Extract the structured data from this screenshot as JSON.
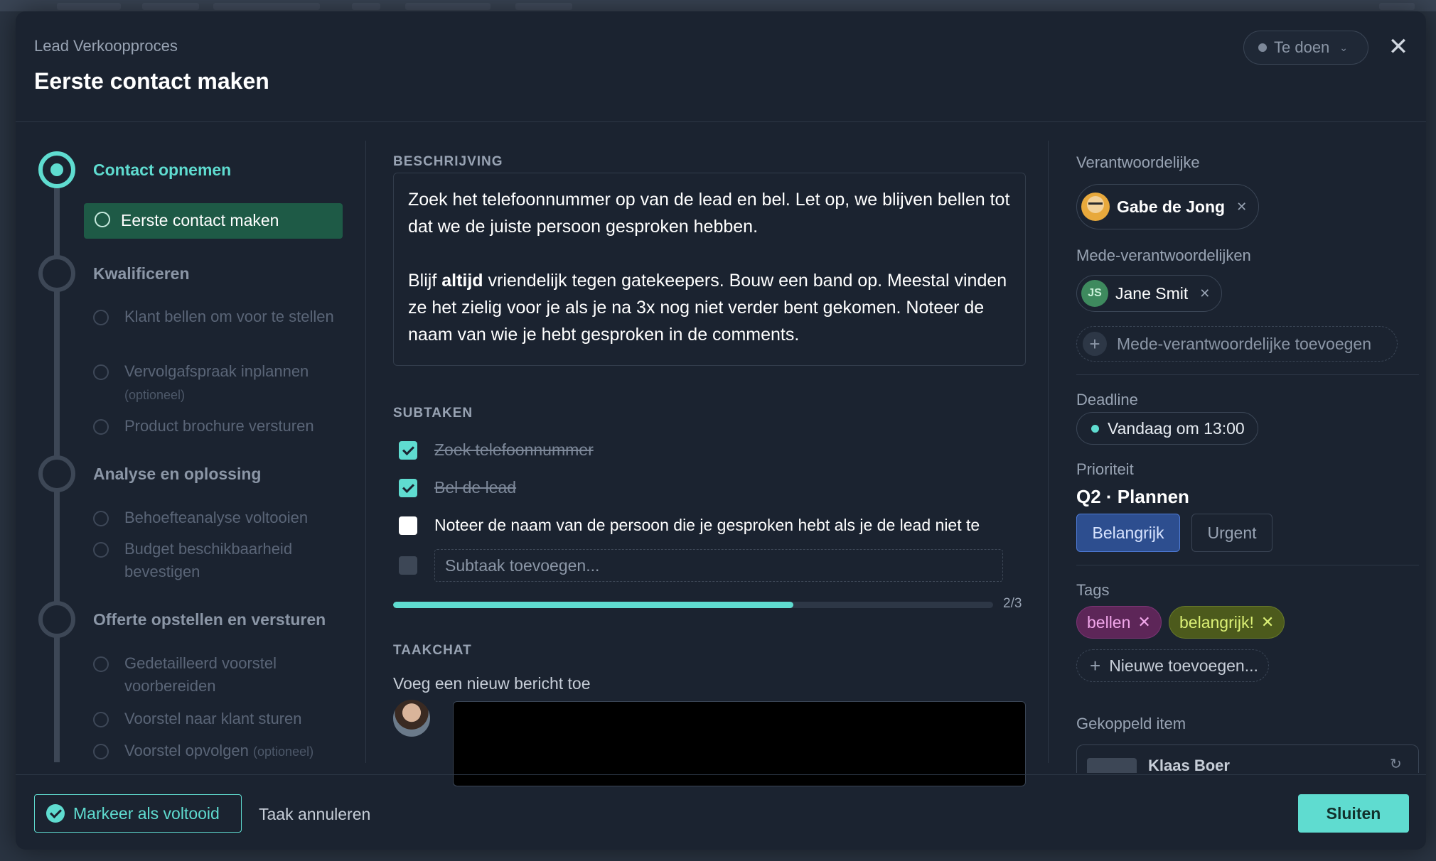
{
  "header": {
    "breadcrumb": "Lead Verkoopproces",
    "title": "Eerste contact maken",
    "status": "Te doen"
  },
  "stepper": {
    "phases": [
      {
        "title": "Contact opnemen",
        "active": true,
        "items": [
          {
            "label": "Eerste contact maken",
            "active": true
          }
        ]
      },
      {
        "title": "Kwalificeren",
        "items": [
          {
            "label": "Klant bellen om voor te stellen"
          },
          {
            "label": "Vervolgafspraak inplannen",
            "optional": "(optioneel)"
          },
          {
            "label": "Product brochure versturen"
          }
        ]
      },
      {
        "title": "Analyse en oplossing",
        "items": [
          {
            "label": "Behoefteanalyse voltooien"
          },
          {
            "label": "Budget beschikbaarheid bevestigen"
          }
        ]
      },
      {
        "title": "Offerte opstellen en versturen",
        "items": [
          {
            "label": "Gedetailleerd voorstel voorbereiden"
          },
          {
            "label": "Voorstel naar klant sturen"
          },
          {
            "label": "Voorstel opvolgen",
            "optional": "(optioneel)"
          }
        ]
      }
    ]
  },
  "description": {
    "label": "BESCHRIJVING",
    "p1": "Zoek het telefoonnummer op van de lead en bel. Let op, we blijven bellen tot dat we de juiste persoon gesproken hebben.",
    "p2_pre": "Blijf ",
    "p2_bold": "altijd",
    "p2_post": " vriendelijk tegen gatekeepers. Bouw een band op. Meestal vinden ze het zielig voor je als je na 3x nog niet verder bent gekomen. Noteer de naam van wie je hebt gesproken in de comments."
  },
  "subtasks": {
    "label": "SUBTAKEN",
    "items": [
      {
        "label": "Zoek telefoonnummer",
        "done": true
      },
      {
        "label": "Bel de lead",
        "done": true
      },
      {
        "label": "Noteer de naam van de persoon die je gesproken hebt als je de lead niet te",
        "done": false
      }
    ],
    "add_placeholder": "Subtaak toevoegen...",
    "progress_text": "2/3",
    "progress_fraction": 0.667
  },
  "chat": {
    "label": "TAAKCHAT",
    "prompt": "Voeg een nieuw bericht toe"
  },
  "sidebar": {
    "owner_label": "Verantwoordelijke",
    "owner_name": "Gabe de Jong",
    "co_owners_label": "Mede-verantwoordelijken",
    "co_owner_initials": "JS",
    "co_owner_name": "Jane Smit",
    "add_co_owner": "Mede-verantwoordelijke toevoegen",
    "deadline_label": "Deadline",
    "deadline_value": "Vandaag om 13:00",
    "priority_label": "Prioriteit",
    "priority_value": "Q2 · Plannen",
    "priority_important": "Belangrijk",
    "priority_urgent": "Urgent",
    "tags_label": "Tags",
    "tags": [
      "bellen",
      "belangrijk!"
    ],
    "add_tag": "Nieuwe toevoegen...",
    "linked_label": "Gekoppeld item",
    "linked_name": "Klaas Boer"
  },
  "footer": {
    "mark_done": "Markeer als voltooid",
    "cancel_task": "Taak annuleren",
    "close": "Sluiten"
  },
  "colors": {
    "accent": "#5fdcd0",
    "surface": "#1b2330",
    "tag_pink": "#5d2658",
    "tag_lime": "#4c5a1c",
    "priority_selected": "#2d4e8f"
  }
}
